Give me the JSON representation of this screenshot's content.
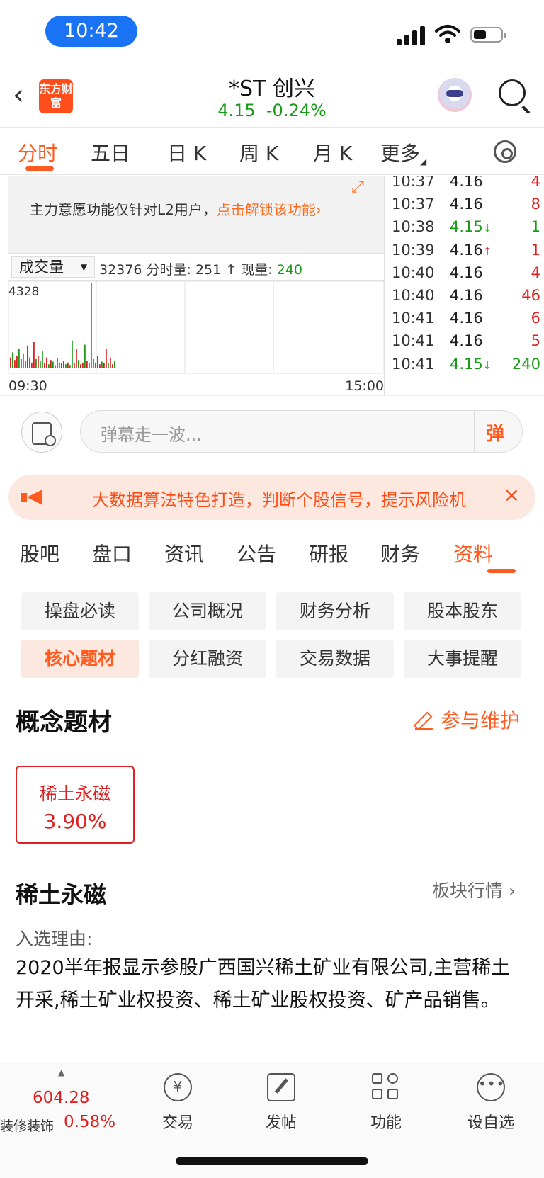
{
  "status_bar": {
    "time": "10:42"
  },
  "header": {
    "logo_text": "东方财富",
    "stock_name": "*ST 创兴",
    "price": "4.15",
    "change_pct": "-0.24%"
  },
  "chart_tabs": [
    {
      "label": "分时",
      "active": true
    },
    {
      "label": "五日",
      "active": false
    },
    {
      "label": "日 K",
      "active": false
    },
    {
      "label": "周 K",
      "active": false
    },
    {
      "label": "月 K",
      "active": false
    },
    {
      "label": "更多",
      "active": false
    }
  ],
  "l2_banner": {
    "text": "主力意愿功能仅针对L2用户，",
    "link": "点击解锁该功能›"
  },
  "volume": {
    "selector": "成交量",
    "total": "32376",
    "period_label": "分时量:",
    "period_value": "251",
    "now_label": "现量:",
    "now_value": "240",
    "max_label": "4328",
    "axis_start": "09:30",
    "axis_end": "15:00"
  },
  "ticks": [
    {
      "time": "10:37",
      "price": "4.16",
      "dir": "",
      "vol": "4"
    },
    {
      "time": "10:37",
      "price": "4.16",
      "dir": "",
      "vol": "8"
    },
    {
      "time": "10:38",
      "price": "4.15",
      "dir": "down",
      "vol": "1"
    },
    {
      "time": "10:39",
      "price": "4.16",
      "dir": "up",
      "vol": "1"
    },
    {
      "time": "10:40",
      "price": "4.16",
      "dir": "",
      "vol": "4"
    },
    {
      "time": "10:40",
      "price": "4.16",
      "dir": "",
      "vol": "46"
    },
    {
      "time": "10:41",
      "price": "4.16",
      "dir": "",
      "vol": "6"
    },
    {
      "time": "10:41",
      "price": "4.16",
      "dir": "",
      "vol": "5"
    },
    {
      "time": "10:41",
      "price": "4.15",
      "dir": "down",
      "vol": "240"
    }
  ],
  "danmaku": {
    "placeholder": "弹幕走一波...",
    "send_label": "弹"
  },
  "notice": {
    "text": "大数据算法特色打造，判断个股信号，提示风险机",
    "close": "×"
  },
  "section_tabs": [
    {
      "label": "股吧",
      "active": false
    },
    {
      "label": "盘口",
      "active": false
    },
    {
      "label": "资讯",
      "active": false
    },
    {
      "label": "公告",
      "active": false
    },
    {
      "label": "研报",
      "active": false
    },
    {
      "label": "财务",
      "active": false
    },
    {
      "label": "资料",
      "active": true
    }
  ],
  "sub_tabs": [
    {
      "label": "操盘必读",
      "active": false
    },
    {
      "label": "公司概况",
      "active": false
    },
    {
      "label": "财务分析",
      "active": false
    },
    {
      "label": "股本股东",
      "active": false
    },
    {
      "label": "核心题材",
      "active": true
    },
    {
      "label": "分红融资",
      "active": false
    },
    {
      "label": "交易数据",
      "active": false
    },
    {
      "label": "大事提醒",
      "active": false
    }
  ],
  "concept": {
    "title": "概念题材",
    "maintain": "参与维护",
    "card_name": "稀土永磁",
    "card_pct": "3.90%",
    "detail_title": "稀土永磁",
    "block_link": "板块行情 ›",
    "reason_label": "入选理由:",
    "reason_text": "2020半年报显示参股广西国兴稀土矿业有限公司,主营稀土开采,稀土矿业权投资、稀土矿业股权投资、矿产品销售。"
  },
  "bottom_bar": {
    "index_value": "604.28",
    "index_name": "装修装饰",
    "index_pct": "0.58%",
    "nav": [
      {
        "label": "交易",
        "icon": "yuan-refresh-icon"
      },
      {
        "label": "发帖",
        "icon": "edit-icon"
      },
      {
        "label": "功能",
        "icon": "grid-icon"
      },
      {
        "label": "设自选",
        "icon": "more-dots-icon"
      }
    ]
  },
  "colors": {
    "accent": "#ff5a1f",
    "up": "#e02020",
    "down": "#1a9c1a"
  },
  "volume_bars": [
    {
      "v": 0.12,
      "c": "r"
    },
    {
      "v": 0.18,
      "c": "g"
    },
    {
      "v": 0.09,
      "c": "r"
    },
    {
      "v": 0.14,
      "c": "r"
    },
    {
      "v": 0.22,
      "c": "g"
    },
    {
      "v": 0.1,
      "c": "r"
    },
    {
      "v": 0.16,
      "c": "g"
    },
    {
      "v": 0.08,
      "c": "r"
    },
    {
      "v": 0.26,
      "c": "r"
    },
    {
      "v": 0.12,
      "c": "g"
    },
    {
      "v": 0.06,
      "c": "r"
    },
    {
      "v": 0.3,
      "c": "r"
    },
    {
      "v": 0.1,
      "c": "g"
    },
    {
      "v": 0.14,
      "c": "r"
    },
    {
      "v": 0.08,
      "c": "g"
    },
    {
      "v": 0.2,
      "c": "g"
    },
    {
      "v": 0.05,
      "c": "r"
    },
    {
      "v": 0.12,
      "c": "r"
    },
    {
      "v": 0.04,
      "c": "g"
    },
    {
      "v": 0.09,
      "c": "r"
    },
    {
      "v": 0.07,
      "c": "g"
    },
    {
      "v": 0.03,
      "c": "r"
    },
    {
      "v": 0.11,
      "c": "r"
    },
    {
      "v": 0.06,
      "c": "g"
    },
    {
      "v": 0.05,
      "c": "r"
    },
    {
      "v": 0.08,
      "c": "r"
    },
    {
      "v": 0.04,
      "c": "g"
    },
    {
      "v": 0.06,
      "c": "r"
    },
    {
      "v": 0.03,
      "c": "g"
    },
    {
      "v": 0.32,
      "c": "g"
    },
    {
      "v": 0.05,
      "c": "r"
    },
    {
      "v": 0.22,
      "c": "r"
    },
    {
      "v": 0.09,
      "c": "g"
    },
    {
      "v": 0.04,
      "c": "r"
    },
    {
      "v": 0.06,
      "c": "r"
    },
    {
      "v": 0.27,
      "c": "g"
    },
    {
      "v": 0.08,
      "c": "r"
    },
    {
      "v": 0.05,
      "c": "g"
    },
    {
      "v": 1.0,
      "c": "g"
    },
    {
      "v": 0.1,
      "c": "r"
    },
    {
      "v": 0.06,
      "c": "g"
    },
    {
      "v": 0.14,
      "c": "r"
    },
    {
      "v": 0.04,
      "c": "r"
    },
    {
      "v": 0.07,
      "c": "g"
    },
    {
      "v": 0.05,
      "c": "r"
    },
    {
      "v": 0.22,
      "c": "r"
    },
    {
      "v": 0.06,
      "c": "g"
    },
    {
      "v": 0.12,
      "c": "r"
    },
    {
      "v": 0.04,
      "c": "r"
    },
    {
      "v": 0.08,
      "c": "g"
    }
  ]
}
